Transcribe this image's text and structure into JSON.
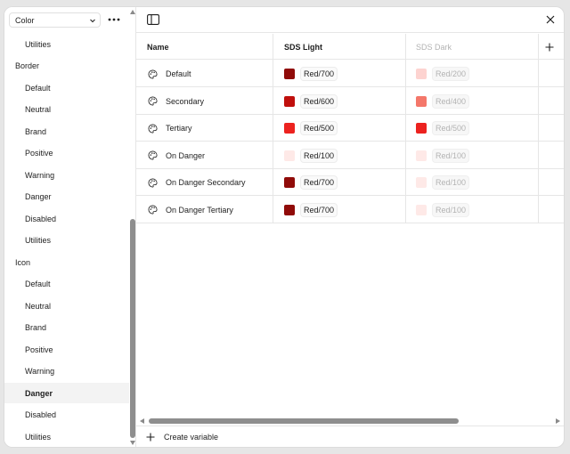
{
  "sidebar": {
    "mode_select": "Color",
    "items": [
      {
        "label": "Utilities",
        "kind": "child",
        "active": false
      },
      {
        "label": "Border",
        "kind": "group",
        "active": false
      },
      {
        "label": "Default",
        "kind": "child",
        "active": false
      },
      {
        "label": "Neutral",
        "kind": "child",
        "active": false
      },
      {
        "label": "Brand",
        "kind": "child",
        "active": false
      },
      {
        "label": "Positive",
        "kind": "child",
        "active": false
      },
      {
        "label": "Warning",
        "kind": "child",
        "active": false
      },
      {
        "label": "Danger",
        "kind": "child",
        "active": false
      },
      {
        "label": "Disabled",
        "kind": "child",
        "active": false
      },
      {
        "label": "Utilities",
        "kind": "child",
        "active": false
      },
      {
        "label": "Icon",
        "kind": "group",
        "active": false
      },
      {
        "label": "Default",
        "kind": "child",
        "active": false
      },
      {
        "label": "Neutral",
        "kind": "child",
        "active": false
      },
      {
        "label": "Brand",
        "kind": "child",
        "active": false
      },
      {
        "label": "Positive",
        "kind": "child",
        "active": false
      },
      {
        "label": "Warning",
        "kind": "child",
        "active": false
      },
      {
        "label": "Danger",
        "kind": "child",
        "active": true
      },
      {
        "label": "Disabled",
        "kind": "child",
        "active": false
      },
      {
        "label": "Utilities",
        "kind": "child",
        "active": false
      }
    ]
  },
  "table": {
    "columns": {
      "name": "Name",
      "light": "SDS Light",
      "dark": "SDS Dark"
    },
    "rows": [
      {
        "name": "Default",
        "light": {
          "label": "Red/700",
          "color": "#900b09"
        },
        "dark": {
          "label": "Red/200",
          "color": "#fdd3d0"
        }
      },
      {
        "name": "Secondary",
        "light": {
          "label": "Red/600",
          "color": "#c00f0c"
        },
        "dark": {
          "label": "Red/400",
          "color": "#f4776a"
        }
      },
      {
        "name": "Tertiary",
        "light": {
          "label": "Red/500",
          "color": "#ec221f"
        },
        "dark": {
          "label": "Red/500",
          "color": "#ec221f"
        }
      },
      {
        "name": "On Danger",
        "light": {
          "label": "Red/100",
          "color": "#fee9e7"
        },
        "dark": {
          "label": "Red/100",
          "color": "#fee9e7"
        }
      },
      {
        "name": "On Danger Secondary",
        "light": {
          "label": "Red/700",
          "color": "#900b09"
        },
        "dark": {
          "label": "Red/100",
          "color": "#fee9e7"
        }
      },
      {
        "name": "On Danger Tertiary",
        "light": {
          "label": "Red/700",
          "color": "#900b09"
        },
        "dark": {
          "label": "Red/100",
          "color": "#fee9e7"
        }
      }
    ]
  },
  "footer": {
    "create_label": "Create variable"
  }
}
